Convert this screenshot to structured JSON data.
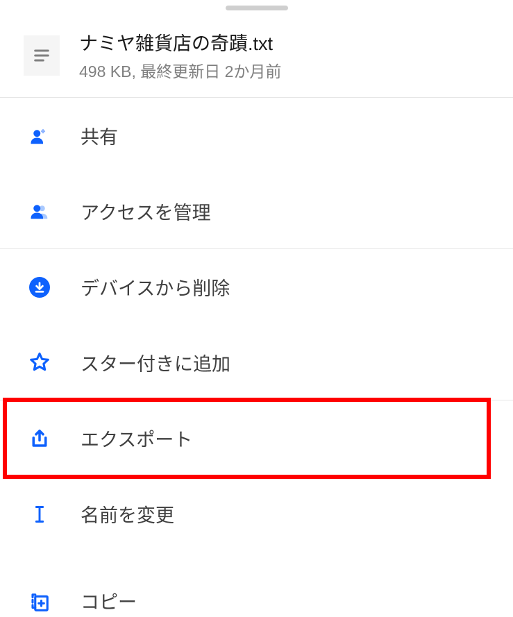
{
  "file": {
    "name": "ナミヤ雑貨店の奇蹟.txt",
    "meta": "498 KB, 最終更新日 2か月前"
  },
  "menu": {
    "share": "共有",
    "manage_access": "アクセスを管理",
    "remove_device": "デバイスから削除",
    "add_star": "スター付きに追加",
    "export": "エクスポート",
    "rename": "名前を変更",
    "copy": "コピー"
  },
  "highlighted_item": "export"
}
